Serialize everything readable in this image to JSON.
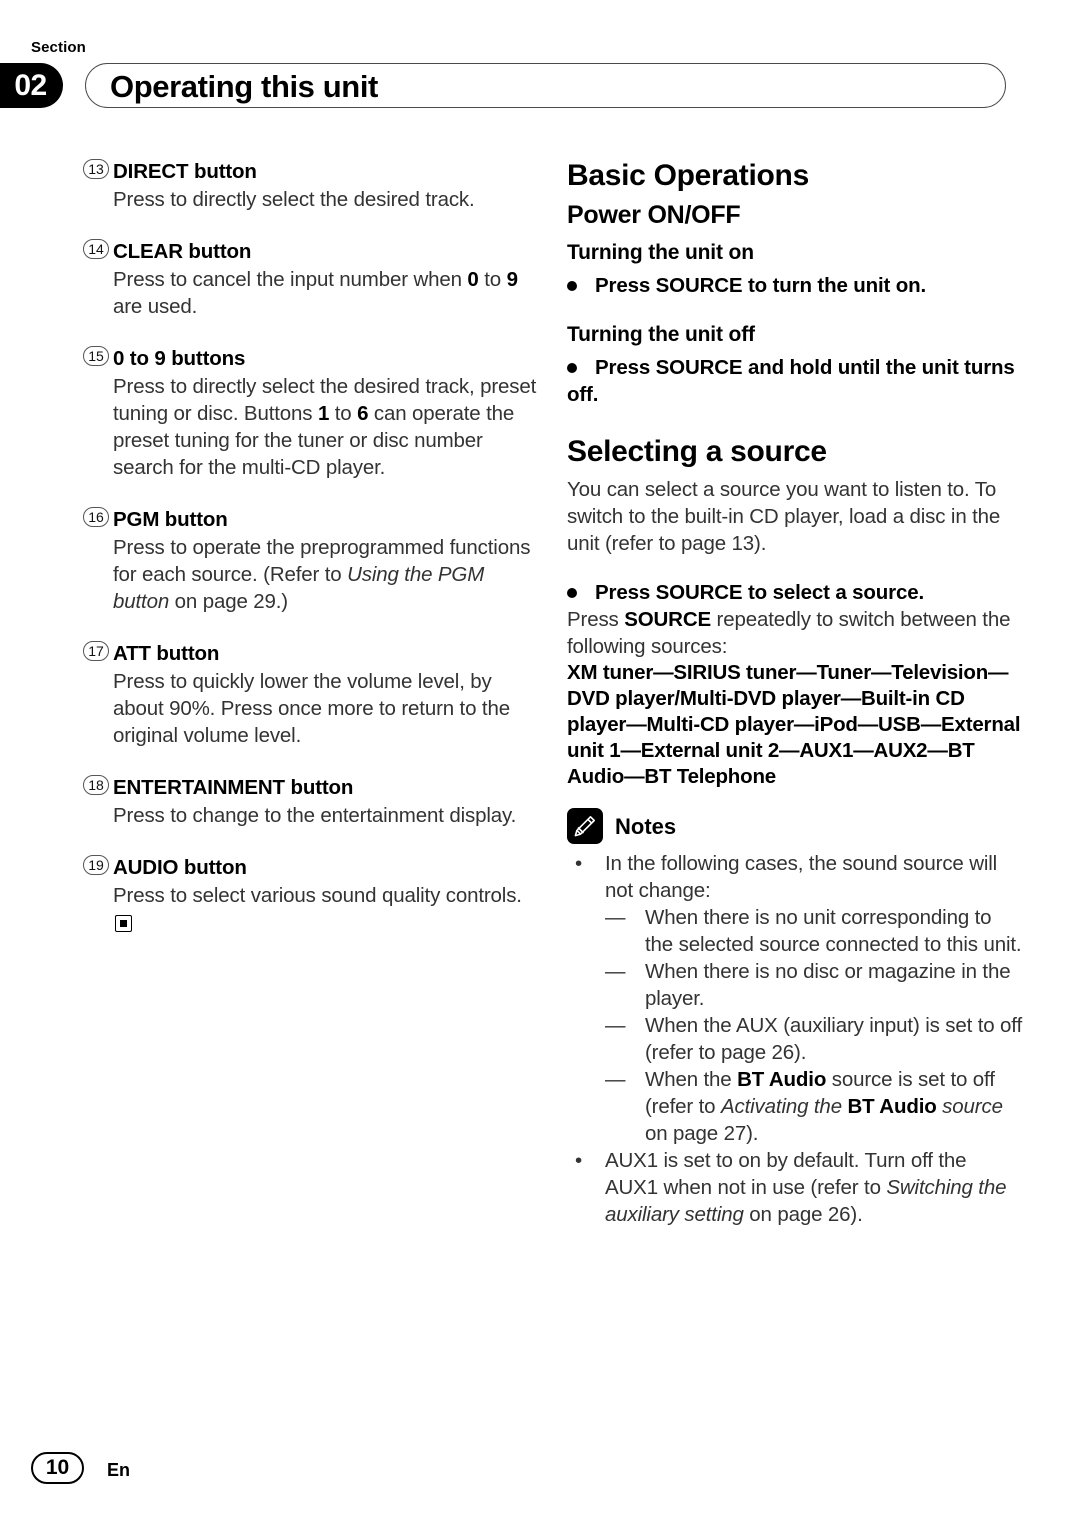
{
  "header": {
    "section_word": "Section",
    "section_number": "02",
    "title": "Operating this unit"
  },
  "left_column": {
    "items": [
      {
        "num": "⑩③",
        "num_display": "13",
        "heading": "DIRECT button",
        "body": "Press to directly select the desired track."
      },
      {
        "num_display": "14",
        "heading": "CLEAR button",
        "body_parts": [
          {
            "text": "Press to cancel the input number when ",
            "style": "normal"
          },
          {
            "text": "0",
            "style": "bold"
          },
          {
            "text": " to ",
            "style": "normal"
          },
          {
            "text": "9",
            "style": "bold"
          },
          {
            "text": " are used.",
            "style": "normal"
          }
        ]
      },
      {
        "num_display": "15",
        "heading": "0 to 9 buttons",
        "body_parts": [
          {
            "text": "Press to directly select the desired track, preset tuning or disc. Buttons ",
            "style": "normal"
          },
          {
            "text": "1",
            "style": "bold"
          },
          {
            "text": " to ",
            "style": "normal"
          },
          {
            "text": "6",
            "style": "bold"
          },
          {
            "text": " can operate the preset tuning for the tuner or disc number search for the multi-CD player.",
            "style": "normal"
          }
        ]
      },
      {
        "num_display": "16",
        "heading": "PGM button",
        "body_parts": [
          {
            "text": "Press to operate the preprogrammed functions for each source. (Refer to ",
            "style": "normal"
          },
          {
            "text": "Using the PGM button",
            "style": "italic"
          },
          {
            "text": " on page 29.)",
            "style": "normal"
          }
        ]
      },
      {
        "num_display": "17",
        "heading": "ATT button",
        "body": "Press to quickly lower the volume level, by about 90%. Press once more to return to the original volume level."
      },
      {
        "num_display": "18",
        "heading": "ENTERTAINMENT button",
        "body": "Press to change to the entertainment display."
      },
      {
        "num_display": "19",
        "heading": "AUDIO button",
        "body": "Press to select various sound quality controls.",
        "end_of_section_mark": true
      }
    ]
  },
  "right_column": {
    "main_heading": "Basic Operations",
    "power_heading": "Power ON/OFF",
    "turning_on_heading": "Turning the unit on",
    "turning_on_bullet": "Press SOURCE to turn the unit on.",
    "turning_off_heading": "Turning the unit off",
    "turning_off_bullet": "Press SOURCE and hold until the unit turns off.",
    "selecting_heading": "Selecting a source",
    "selecting_intro": "You can select a source you want to listen to. To switch to the built-in CD player, load a disc in the unit (refer to page 13).",
    "select_bullet": "Press SOURCE to select a source.",
    "select_body_parts": [
      {
        "text": "Press ",
        "style": "normal"
      },
      {
        "text": "SOURCE",
        "style": "bold"
      },
      {
        "text": " repeatedly to switch between the following sources:",
        "style": "normal"
      }
    ],
    "source_list": "XM tuner—SIRIUS tuner—Tuner—Television—DVD player/Multi-DVD player—Built-in CD player—Multi-CD player—iPod—USB—External unit 1—External unit 2—AUX1—AUX2—BT Audio—BT Telephone",
    "notes_label": "Notes",
    "notes_icon": "pencil-icon",
    "notes": [
      {
        "marker": "•",
        "text": "In the following cases, the sound source will not change:",
        "subitems": [
          {
            "marker": "—",
            "parts": [
              {
                "text": "When there is no unit corresponding to the selected source connected to this unit.",
                "style": "normal"
              }
            ]
          },
          {
            "marker": "—",
            "parts": [
              {
                "text": "When there is no disc or magazine in the player.",
                "style": "normal"
              }
            ]
          },
          {
            "marker": "—",
            "parts": [
              {
                "text": "When the AUX (auxiliary input) is set to off (refer to page 26).",
                "style": "normal"
              }
            ]
          },
          {
            "marker": "—",
            "parts": [
              {
                "text": "When the ",
                "style": "normal"
              },
              {
                "text": "BT Audio",
                "style": "bold"
              },
              {
                "text": " source is set to off (refer to ",
                "style": "normal"
              },
              {
                "text": "Activating the ",
                "style": "italic"
              },
              {
                "text": "BT Audio",
                "style": "bold"
              },
              {
                "text": " source",
                "style": "italic"
              },
              {
                "text": " on page 27).",
                "style": "normal"
              }
            ]
          }
        ]
      },
      {
        "marker": "•",
        "parts": [
          {
            "text": "AUX1 is set to on by default. Turn off the AUX1 when not in use (refer to ",
            "style": "normal"
          },
          {
            "text": "Switching the auxiliary setting",
            "style": "italic"
          },
          {
            "text": " on page 26).",
            "style": "normal"
          }
        ]
      }
    ]
  },
  "footer": {
    "page_number": "10",
    "language_code": "En"
  }
}
